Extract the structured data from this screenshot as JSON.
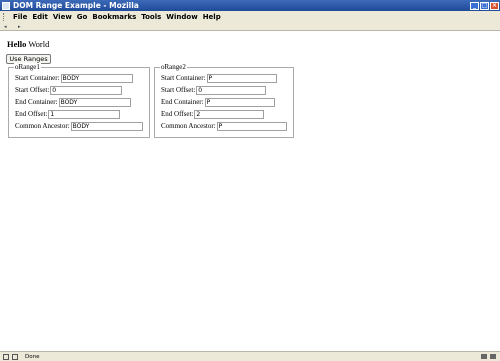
{
  "window": {
    "title": "DOM Range Example - Mozilla"
  },
  "menu": [
    "File",
    "Edit",
    "View",
    "Go",
    "Bookmarks",
    "Tools",
    "Window",
    "Help"
  ],
  "page": {
    "hello_bold": "Hello",
    "hello_rest": " World",
    "button_label": "Use Ranges"
  },
  "range1": {
    "legend": "oRange1",
    "start_container_label": "Start Container:",
    "start_container": "BODY",
    "start_offset_label": "Start Offset:",
    "start_offset": "0",
    "end_container_label": "End Container:",
    "end_container": "BODY",
    "end_offset_label": "End Offset:",
    "end_offset": "1",
    "common_ancestor_label": "Common Ancestor:",
    "common_ancestor": "BODY"
  },
  "range2": {
    "legend": "oRange2",
    "start_container_label": "Start Container:",
    "start_container": "P",
    "start_offset_label": "Start Offset:",
    "start_offset": "0",
    "end_container_label": "End Container:",
    "end_container": "P",
    "end_offset_label": "End Offset:",
    "end_offset": "2",
    "common_ancestor_label": "Common Ancestor:",
    "common_ancestor": "P"
  },
  "status": {
    "text": "Done"
  }
}
